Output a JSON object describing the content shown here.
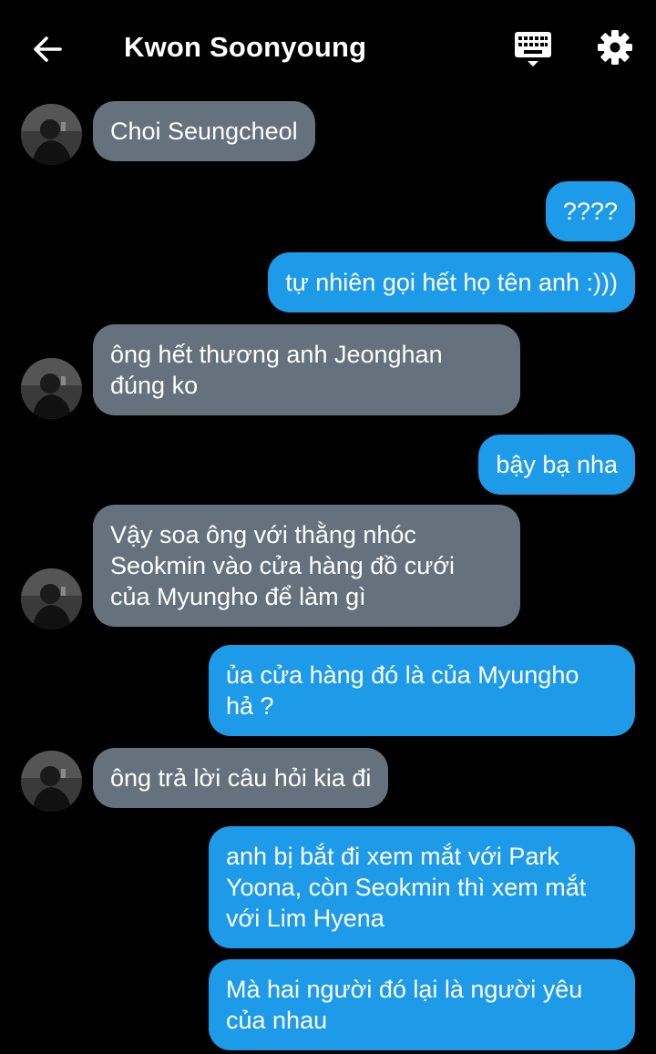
{
  "header": {
    "title": "Kwon Soonyoung",
    "back_icon": "arrow-left-icon",
    "keyboard_icon": "keyboard-icon",
    "settings_icon": "gear-icon"
  },
  "colors": {
    "background": "#000000",
    "incoming_bubble": "#65727e",
    "outgoing_bubble": "#1e9be8"
  },
  "messages": [
    {
      "side": "in",
      "lines": [
        "Choi Seungcheol"
      ]
    },
    {
      "side": "out",
      "lines": [
        "????"
      ]
    },
    {
      "side": "out",
      "lines": [
        "tự nhiên gọi hết họ tên anh :)))"
      ]
    },
    {
      "side": "in",
      "lines": [
        "ông hết thương anh Jeonghan",
        "đúng ko"
      ]
    },
    {
      "side": "out",
      "lines": [
        "bậy bạ nha"
      ]
    },
    {
      "side": "in",
      "lines": [
        "Vậy soa ông với thằng nhóc",
        "Seokmin vào cửa hàng đồ cưới",
        "của Myungho để làm gì"
      ]
    },
    {
      "side": "out",
      "lines": [
        "ủa cửa hàng đó là của Myungho",
        "hả ?"
      ]
    },
    {
      "side": "in",
      "lines": [
        "ông trả lời câu hỏi kia đi"
      ]
    },
    {
      "side": "out",
      "lines": [
        "anh bị bắt đi xem mắt với Park",
        "Yoona, còn Seokmin thì xem mắt",
        "với Lim Hyena"
      ]
    },
    {
      "side": "out",
      "lines": [
        "Mà hai người đó lại là người yêu",
        "của nhau"
      ]
    }
  ]
}
